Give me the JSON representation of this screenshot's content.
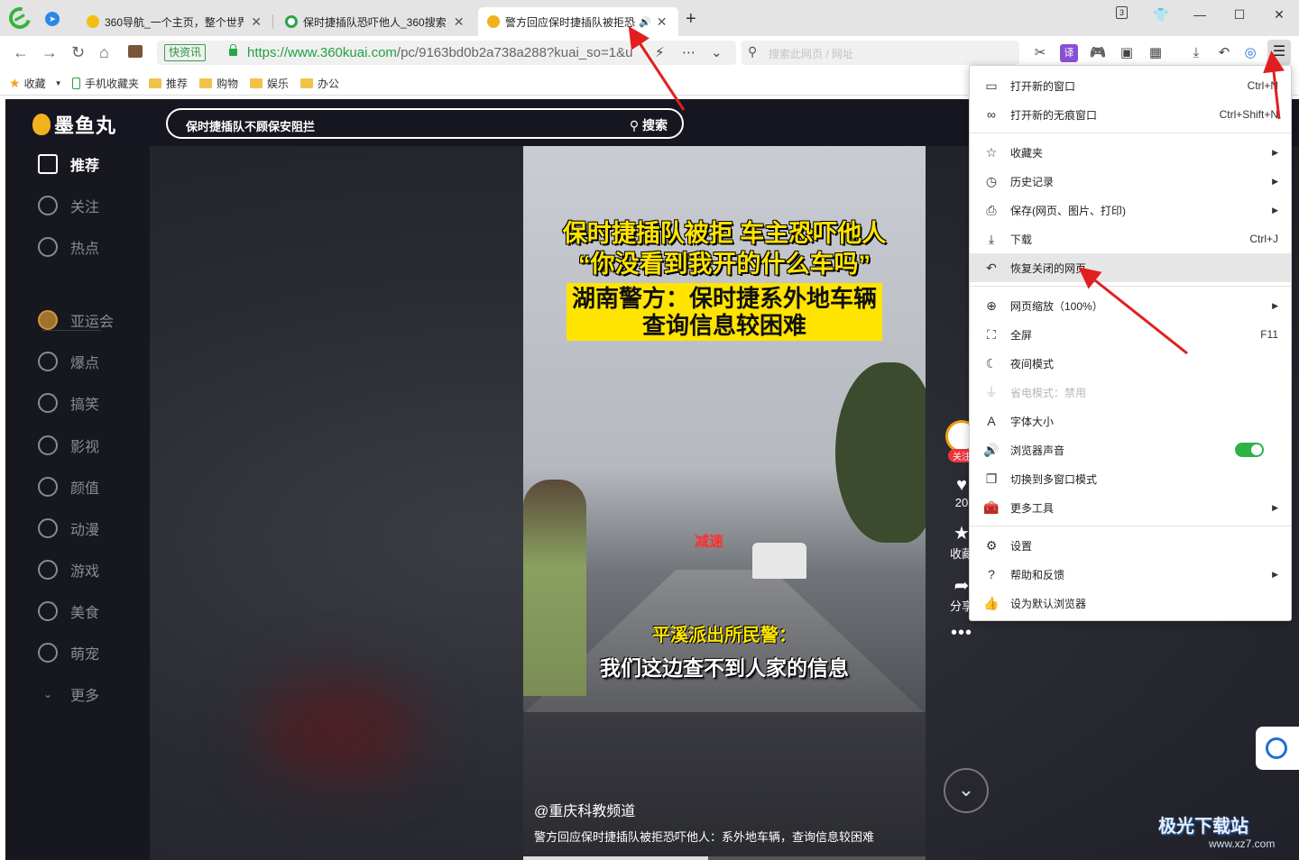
{
  "browser": {
    "tabs": [
      {
        "title": "360导航_一个主页，整个世界",
        "color": "#f2c011"
      },
      {
        "title": "保时捷插队恐吓他人_360搜索",
        "color": "#2aa44a"
      },
      {
        "title": "警方回应保时捷插队被拒恐",
        "color": "#f2b21c",
        "audio": "🔊"
      }
    ],
    "tab_count": "3",
    "new_tab": "+",
    "address": {
      "cert_label": "快资讯",
      "url_host": "https://www.360kuai.com",
      "url_path": "/pc/9163bd0b2a738a288?kuai_so=1&u"
    },
    "search_placeholder": "搜索此网页 / 网址"
  },
  "bookmarks": [
    {
      "label": "收藏",
      "kind": "star-icon",
      "has_dropdown": true
    },
    {
      "label": "手机收藏夹",
      "kind": "phone-icon"
    },
    {
      "label": "推荐",
      "kind": "folder-icon"
    },
    {
      "label": "购物",
      "kind": "folder-icon"
    },
    {
      "label": "娱乐",
      "kind": "folder-icon"
    },
    {
      "label": "办公",
      "kind": "folder-icon"
    }
  ],
  "site": {
    "logo": "墨鱼丸",
    "search_query": "保时捷插队不顾保安阻拦",
    "search_button": "搜索",
    "nav": [
      {
        "label": "推荐",
        "icon": "home-icon",
        "active": true
      },
      {
        "label": "关注",
        "icon": "heart-icon"
      },
      {
        "label": "热点",
        "icon": "flame-icon"
      },
      {
        "label": "亚运会",
        "icon": "medal-icon"
      },
      {
        "label": "爆点",
        "icon": "eye-icon"
      },
      {
        "label": "搞笑",
        "icon": "smile-icon"
      },
      {
        "label": "影视",
        "icon": "play-icon"
      },
      {
        "label": "颜值",
        "icon": "shirt-icon"
      },
      {
        "label": "动漫",
        "icon": "bear-icon"
      },
      {
        "label": "游戏",
        "icon": "gamepad-icon"
      },
      {
        "label": "美食",
        "icon": "dish-icon"
      },
      {
        "label": "萌宠",
        "icon": "pet-icon"
      },
      {
        "label": "更多",
        "icon": "chevron-down-icon"
      }
    ]
  },
  "video": {
    "caption_line1": "保时捷插队被拒 车主恐吓他人",
    "caption_line2": "“你没看到我开的什么车吗”",
    "caption_box1": "湖南警方：保时捷系外地车辆",
    "caption_box2": "查询信息较困难",
    "road_sign": "减速",
    "subtitle_speaker": "平溪派出所民警：",
    "subtitle_text": "我们这边查不到人家的信息",
    "author": "@重庆科教频道",
    "description": "警方回应保时捷插队被拒恐吓他人：系外地车辆，查询信息较困难",
    "progress": 0.46,
    "actions": {
      "follow": "关注",
      "like_count": "20",
      "favorite": "收藏",
      "share": "分享"
    }
  },
  "menu": {
    "items": [
      {
        "label": "打开新的窗口",
        "icon": "window-icon",
        "shortcut": "Ctrl+N"
      },
      {
        "label": "打开新的无痕窗口",
        "icon": "incognito-icon",
        "shortcut": "Ctrl+Shift+N"
      },
      {
        "label": "收藏夹",
        "icon": "star-list-icon",
        "submenu": true
      },
      {
        "label": "历史记录",
        "icon": "clock-icon",
        "submenu": true
      },
      {
        "label": "保存(网页、图片、打印)",
        "icon": "save-icon",
        "submenu": true
      },
      {
        "label": "下载",
        "icon": "download-icon",
        "shortcut": "Ctrl+J"
      },
      {
        "label": "恢复关闭的网页",
        "icon": "undo-icon",
        "highlighted": true
      },
      {
        "label": "网页缩放（100%）",
        "icon": "zoom-icon",
        "submenu": true
      },
      {
        "label": "全屏",
        "icon": "fullscreen-icon",
        "shortcut": "F11"
      },
      {
        "label": "夜间模式",
        "icon": "moon-icon"
      },
      {
        "label": "省电模式：禁用",
        "icon": "plug-icon",
        "disabled": true
      },
      {
        "label": "字体大小",
        "icon": "font-icon"
      },
      {
        "label": "浏览器声音",
        "icon": "speaker-icon",
        "toggle": true
      },
      {
        "label": "切换到多窗口模式",
        "icon": "windows-icon"
      },
      {
        "label": "更多工具",
        "icon": "toolbox-icon",
        "submenu": true
      },
      {
        "label": "设置",
        "icon": "gear-icon"
      },
      {
        "label": "帮助和反馈",
        "icon": "help-icon",
        "submenu": true
      },
      {
        "label": "设为默认浏览器",
        "icon": "thumbs-up-icon"
      }
    ]
  },
  "watermark": {
    "brand": "极光下载站",
    "url": "www.xz7.com"
  },
  "colors": {
    "annotation_arrow": "#e02020",
    "toggle_on": "#2db245",
    "accent_yellow": "#ffe400"
  }
}
